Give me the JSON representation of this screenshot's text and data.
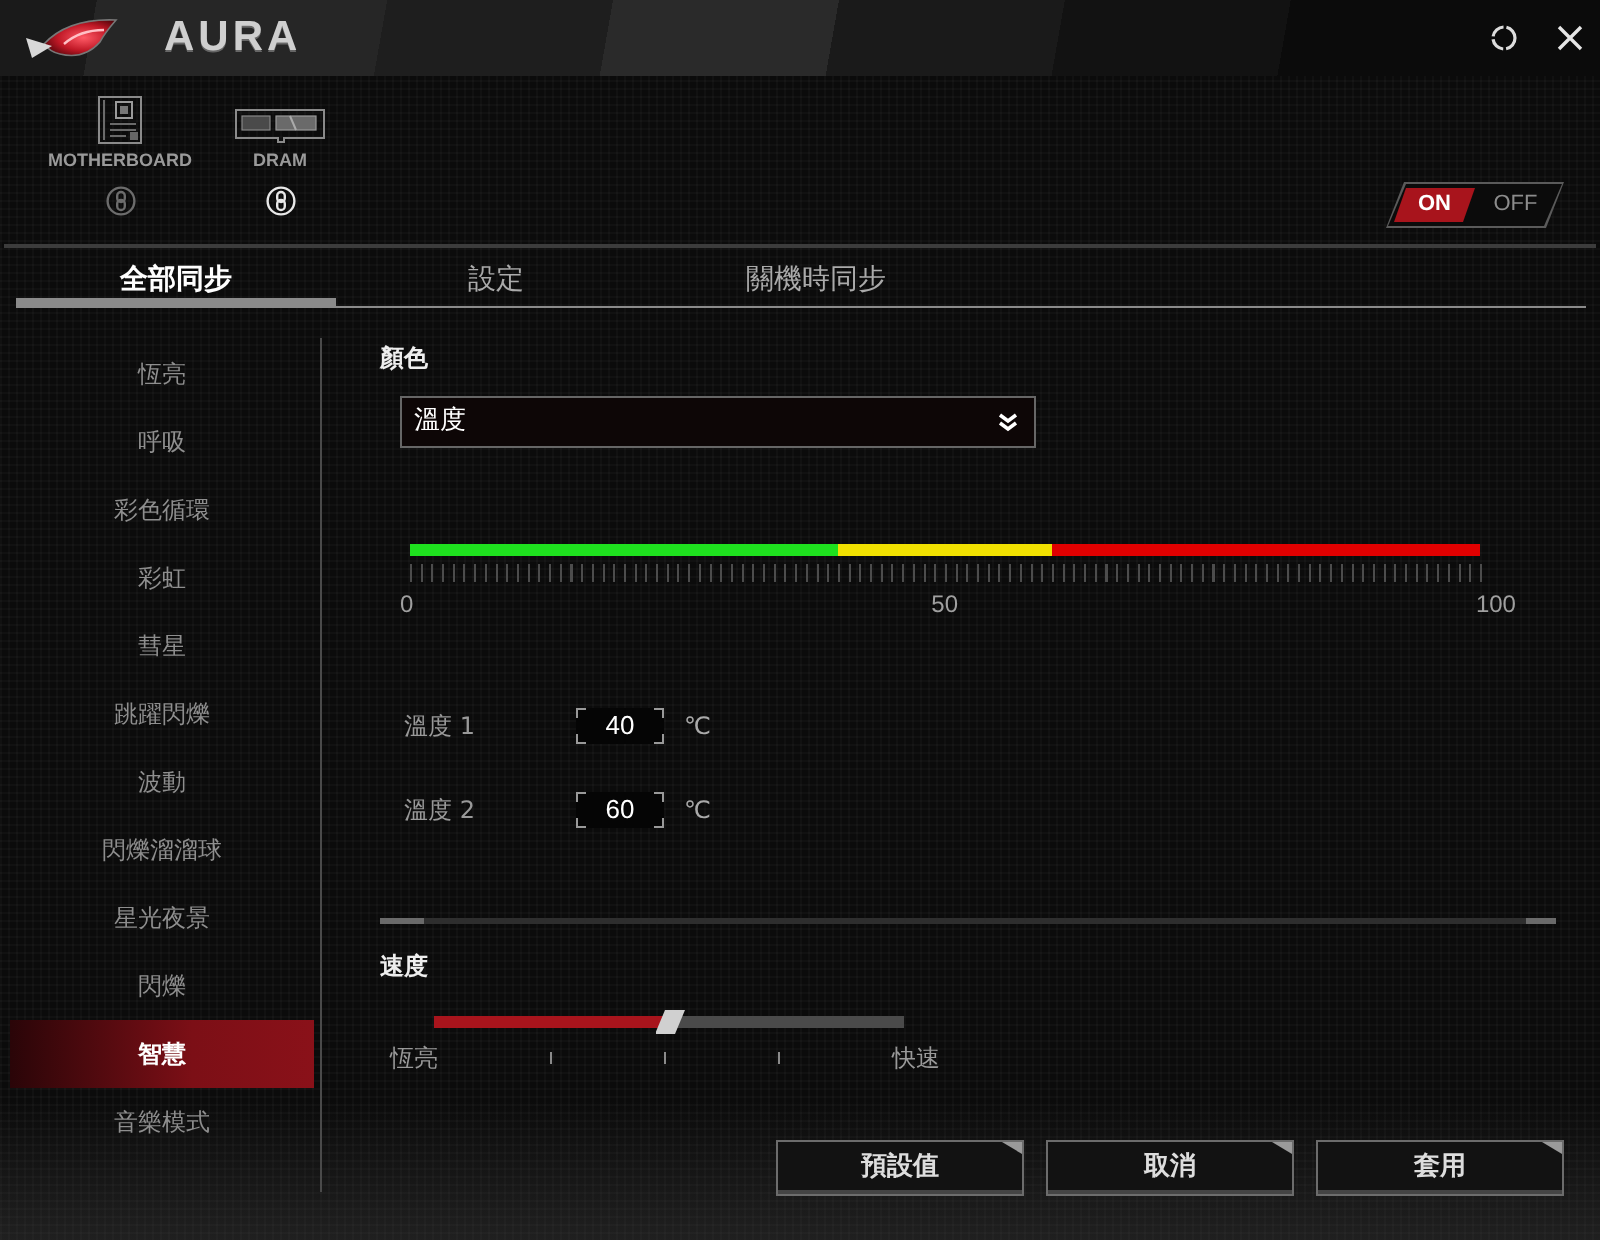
{
  "window": {
    "title": "AURA"
  },
  "devices": [
    {
      "kind": "motherboard",
      "label": "MOTHERBOARD",
      "linked": false
    },
    {
      "kind": "dram",
      "label": "DRAM",
      "linked": true
    }
  ],
  "power_switch": {
    "on_label": "ON",
    "off_label": "OFF",
    "on": true
  },
  "tabs": [
    {
      "label": "全部同步",
      "selected": true
    },
    {
      "label": "設定",
      "selected": false
    },
    {
      "label": "關機時同步",
      "selected": false
    }
  ],
  "effects": [
    {
      "label": "恆亮",
      "selected": false
    },
    {
      "label": "呼吸",
      "selected": false
    },
    {
      "label": "彩色循環",
      "selected": false
    },
    {
      "label": "彩虹",
      "selected": false
    },
    {
      "label": "彗星",
      "selected": false
    },
    {
      "label": "跳躍閃爍",
      "selected": false
    },
    {
      "label": "波動",
      "selected": false
    },
    {
      "label": "閃爍溜溜球",
      "selected": false
    },
    {
      "label": "星光夜景",
      "selected": false
    },
    {
      "label": "閃爍",
      "selected": false
    },
    {
      "label": "智慧",
      "selected": true
    },
    {
      "label": "音樂模式",
      "selected": false
    }
  ],
  "color": {
    "label": "顏色",
    "dropdown": {
      "value": "溫度"
    },
    "segments": [
      {
        "color": "#1ee01e"
      },
      {
        "color": "#f0e000"
      },
      {
        "color": "#e00000"
      }
    ],
    "scale_labels": [
      "0",
      "50",
      "100"
    ]
  },
  "temperatures": [
    {
      "label": "溫度 1",
      "value": "40",
      "unit": "℃"
    },
    {
      "label": "溫度 2",
      "value": "60",
      "unit": "℃"
    }
  ],
  "speed": {
    "label": "速度",
    "level": 0.5,
    "min_label": "恆亮",
    "max_label": "快速"
  },
  "buttons": [
    "預設值",
    "取消",
    "套用"
  ]
}
